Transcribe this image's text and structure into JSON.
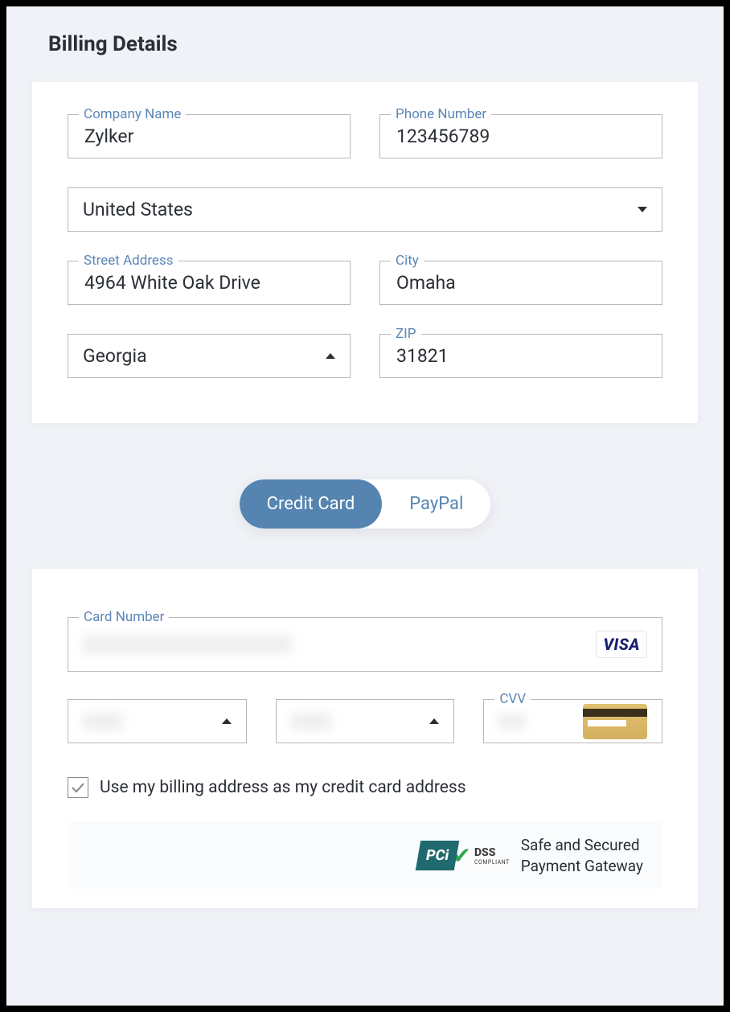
{
  "page": {
    "title": "Billing Details"
  },
  "billing": {
    "company_label": "Company Name",
    "company_value": "Zylker",
    "phone_label": "Phone Number",
    "phone_value": "123456789",
    "country_value": "United States",
    "street_label": "Street Address",
    "street_value": "4964 White Oak Drive",
    "city_label": "City",
    "city_value": "Omaha",
    "state_value": "Georgia",
    "zip_label": "ZIP",
    "zip_value": "31821"
  },
  "payment_toggle": {
    "credit_card": "Credit Card",
    "paypal": "PayPal",
    "active": "credit_card"
  },
  "card": {
    "number_label": "Card Number",
    "brand": "VISA",
    "cvv_label": "CVV",
    "use_billing_label": "Use my billing address as my credit card address",
    "use_billing_checked": true
  },
  "security": {
    "pci_text": "PCi",
    "dss_text": "DSS",
    "compliant_text": "COMPLIANT",
    "line1": "Safe and Secured",
    "line2": "Payment Gateway"
  }
}
